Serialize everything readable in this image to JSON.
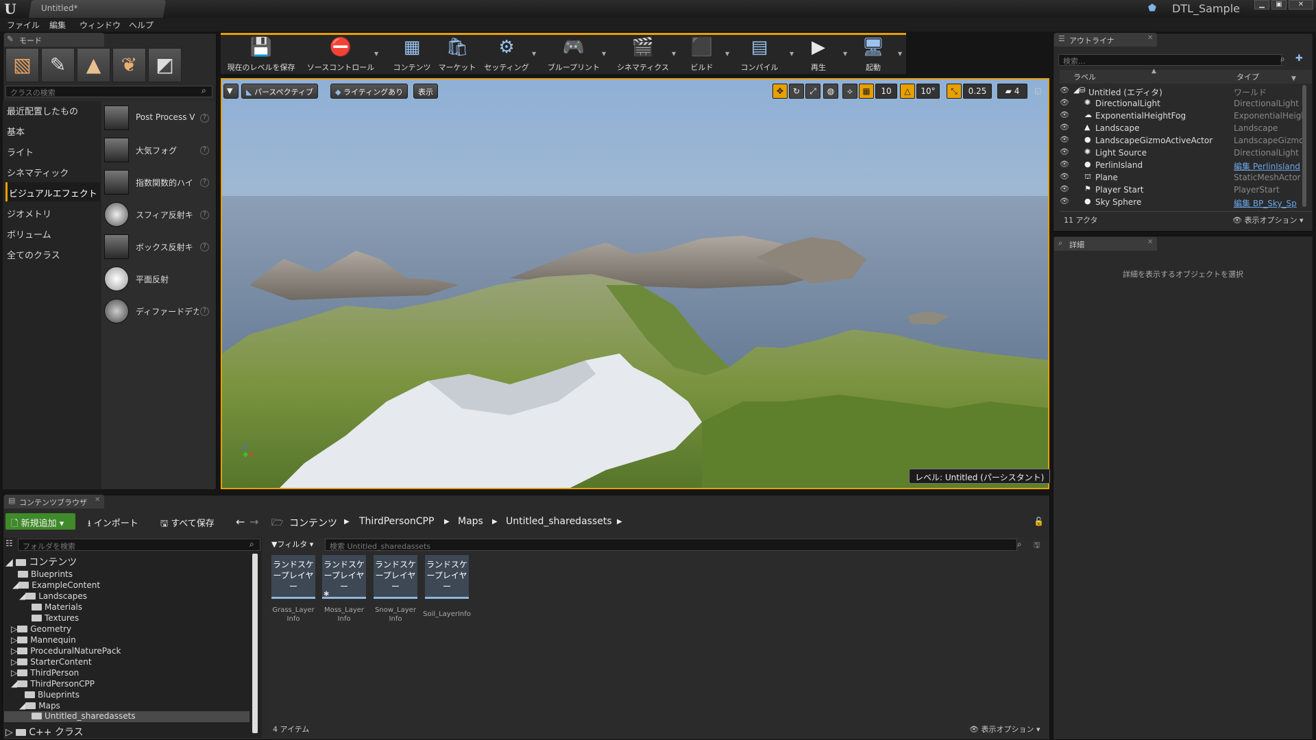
{
  "window": {
    "tab_title": "Untitled*",
    "project_name": "DTL_Sample",
    "logo": "U"
  },
  "menu": [
    "ファイル",
    "編集",
    "ウィンドウ",
    "ヘルプ"
  ],
  "modes": {
    "tab_label": "モード",
    "search_placeholder": "クラスの検索",
    "categories": [
      "最近配置したもの",
      "基本",
      "ライト",
      "シネマティック",
      "ビジュアルエフェクト",
      "ジオメトリ",
      "ボリューム",
      "全てのクラス"
    ],
    "active_category": "ビジュアルエフェクト",
    "items": [
      {
        "label": "Post Process V",
        "help": true
      },
      {
        "label": "大気フォグ",
        "help": true
      },
      {
        "label": "指数関数的ハイ",
        "help": true
      },
      {
        "label": "スフィア反射キ",
        "help": true
      },
      {
        "label": "ボックス反射キ",
        "help": true
      },
      {
        "label": "平面反射",
        "help": false
      },
      {
        "label": "ディファードデカ",
        "help": true
      }
    ]
  },
  "toolbar": {
    "buttons": [
      {
        "label": "現在のレベルを保存",
        "icon": "save-icon",
        "glyph": "💾"
      },
      {
        "label": "ソースコントロール",
        "icon": "source-control-icon",
        "glyph": "⛔"
      },
      {
        "label": "コンテンツ",
        "icon": "content-icon",
        "glyph": "▦"
      },
      {
        "label": "マーケット",
        "icon": "marketplace-icon",
        "glyph": "🛍"
      },
      {
        "label": "セッティング",
        "icon": "settings-icon",
        "glyph": "⚙"
      },
      {
        "label": "ブループリント",
        "icon": "blueprint-icon",
        "glyph": "🎮"
      },
      {
        "label": "シネマティクス",
        "icon": "cinematics-icon",
        "glyph": "🎬"
      },
      {
        "label": "ビルド",
        "icon": "build-icon",
        "glyph": "⬛"
      },
      {
        "label": "コンパイル",
        "icon": "compile-icon",
        "glyph": "▤"
      },
      {
        "label": "再生",
        "icon": "play-icon",
        "glyph": "▶"
      },
      {
        "label": "起動",
        "icon": "launch-icon",
        "glyph": "🖥"
      }
    ]
  },
  "viewport": {
    "perspective": "パースペクティブ",
    "lighting": "ライティングあり",
    "show": "表示",
    "grid_snap": "10",
    "rotation_snap": "10°",
    "scale_snap": "0.25",
    "camera_speed": "4",
    "level_label": "レベル:  Untitled (パーシスタント)"
  },
  "outliner": {
    "tab_label": "アウトライナ",
    "search_placeholder": "検索...",
    "col_label": "ラベル",
    "col_type": "タイプ",
    "rows": [
      {
        "label": "Untitled (エディタ)",
        "type": "ワールド",
        "link": false,
        "root": true
      },
      {
        "label": "DirectionalLight",
        "type": "DirectionalLight",
        "link": false
      },
      {
        "label": "ExponentialHeightFog",
        "type": "ExponentialHeigh",
        "link": false
      },
      {
        "label": "Landscape",
        "type": "Landscape",
        "link": false
      },
      {
        "label": "LandscapeGizmoActiveActor",
        "type": "LandscapeGizmo.",
        "link": false
      },
      {
        "label": "Light Source",
        "type": "DirectionalLight",
        "link": false
      },
      {
        "label": "PerlinIsland",
        "type": "編集 PerlinIsland",
        "link": true
      },
      {
        "label": "Plane",
        "type": "StaticMeshActor",
        "link": false
      },
      {
        "label": "Player Start",
        "type": "PlayerStart",
        "link": false
      },
      {
        "label": "Sky Sphere",
        "type": "編集 BP_Sky_Sp",
        "link": true
      }
    ],
    "count": "11 アクタ",
    "view_options": "表示オプション"
  },
  "details": {
    "tab_label": "詳細",
    "empty_text": "詳細を表示するオブジェクトを選択"
  },
  "content_browser": {
    "tab_label": "コンテンツブラウザ",
    "add_new": "新規追加",
    "import": "インポート",
    "save_all": "すべて保存",
    "breadcrumb": [
      "コンテンツ",
      "ThirdPersonCPP",
      "Maps",
      "Untitled_sharedassets"
    ],
    "folder_search_placeholder": "フォルダを検索",
    "filter": "フィルタ",
    "asset_search_placeholder": "検索 Untitled_sharedassets",
    "tree": [
      {
        "label": "コンテンツ",
        "depth": 0,
        "arrow": "◢",
        "big": true
      },
      {
        "label": "Blueprints",
        "depth": 1,
        "arrow": ""
      },
      {
        "label": "ExampleContent",
        "depth": 1,
        "arrow": "◢"
      },
      {
        "label": "Landscapes",
        "depth": 2,
        "arrow": "◢"
      },
      {
        "label": "Materials",
        "depth": 3,
        "arrow": ""
      },
      {
        "label": "Textures",
        "depth": 3,
        "arrow": ""
      },
      {
        "label": "Geometry",
        "depth": 1,
        "arrow": "▷"
      },
      {
        "label": "Mannequin",
        "depth": 1,
        "arrow": "▷"
      },
      {
        "label": "ProceduralNaturePack",
        "depth": 1,
        "arrow": "▷"
      },
      {
        "label": "StarterContent",
        "depth": 1,
        "arrow": "▷"
      },
      {
        "label": "ThirdPerson",
        "depth": 1,
        "arrow": "▷"
      },
      {
        "label": "ThirdPersonCPP",
        "depth": 1,
        "arrow": "◢"
      },
      {
        "label": "Blueprints",
        "depth": 2,
        "arrow": ""
      },
      {
        "label": "Maps",
        "depth": 2,
        "arrow": "◢"
      },
      {
        "label": "Untitled_sharedassets",
        "depth": 3,
        "arrow": "",
        "selected": true
      },
      {
        "label": "C++ クラス",
        "depth": 0,
        "arrow": "▷",
        "big": true
      }
    ],
    "assets": [
      {
        "thumb": "ランドスケープレイヤー",
        "name": "Grass_Layer Info"
      },
      {
        "thumb": "ランドスケープレイヤー",
        "name": "Moss_Layer Info"
      },
      {
        "thumb": "ランドスケープレイヤー",
        "name": "Snow_Layer Info"
      },
      {
        "thumb": "ランドスケープレイヤー",
        "name": "Soil_LayerInfo"
      }
    ],
    "item_count": "4 アイテム",
    "view_options": "表示オプション"
  },
  "colors": {
    "accent": "#e8a000",
    "add_new": "#3f8a2a",
    "link": "#6aa6e8"
  }
}
